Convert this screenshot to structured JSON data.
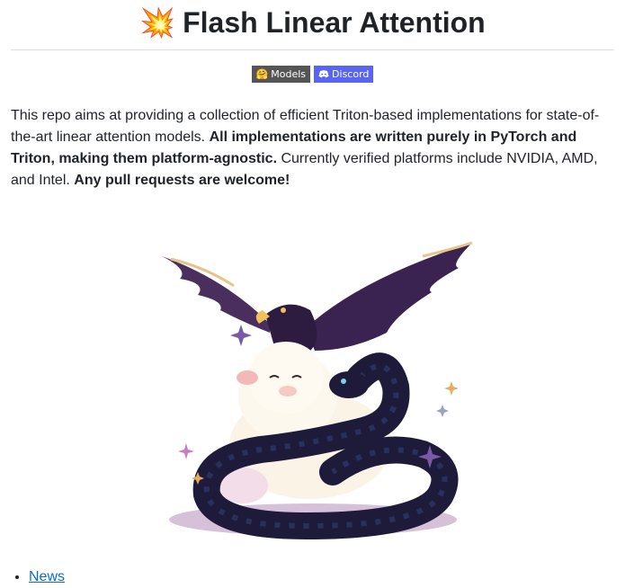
{
  "header": {
    "emoji": "💥",
    "title": "Flash Linear Attention"
  },
  "badges": {
    "models_icon": "🤗",
    "models_label": "Models",
    "discord_label": "Discord"
  },
  "intro": {
    "text1": "This repo aims at providing a collection of efficient Triton-based implementations for state-of-the-art linear attention models. ",
    "bold1": "All implementations are written purely in PyTorch and Triton, making them platform-agnostic.",
    "text2": " Currently verified platforms include NVIDIA, AMD, and Intel. ",
    "bold2": "Any pull requests are welcome!"
  },
  "toc": {
    "items": [
      "News"
    ]
  },
  "colors": {
    "link": "#0969da",
    "discord": "#5865f2",
    "models_badge": "#555555"
  }
}
